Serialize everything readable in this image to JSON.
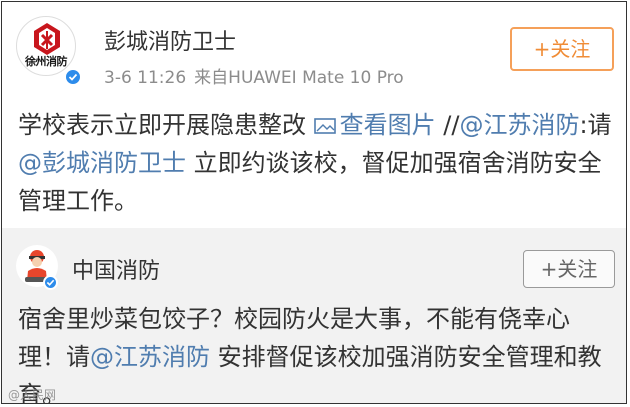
{
  "post": {
    "avatar_label": "徐州消防",
    "username": "彭城消防卫士",
    "date": "3-6 11:26",
    "source": "来自HUAWEI Mate 10 Pro",
    "follow_label": "+关注",
    "text_part1": "学校表示立即开展隐患整改 ",
    "view_image_label": "查看图片",
    "text_part2": " //",
    "mention_jiangsu": "@江苏消防",
    "text_part3": ":请",
    "mention_pengcheng": "@彭城消防卫士",
    "text_part4": " 立即约谈该校，督促加强宿舍消防安全管理工作。"
  },
  "retweet": {
    "username": "中国消防",
    "follow_label": "+关注",
    "text_part1": "宿舍里炒菜包饺子？校园防火是大事，不能有侥幸心理！请",
    "mention_jiangsu": "@江苏消防",
    "text_part2": " 安排督促该校加强消防安全管理和教育。"
  },
  "watermark": "@人民网",
  "colors": {
    "link": "#507daf",
    "follow_orange": "#f08c36",
    "verified_blue": "#2d8ceb",
    "retweet_bg": "#f2f2f2"
  },
  "icons": {
    "avatar": "fire-department-emblem",
    "verified": "verified-badge-icon",
    "image": "image-icon",
    "rt_avatar": "firefighter-mascot"
  }
}
